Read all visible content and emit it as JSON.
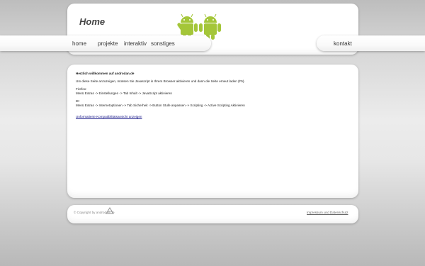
{
  "header": {
    "title": "Home"
  },
  "nav": {
    "items": [
      {
        "label": "home"
      },
      {
        "label": "projekte"
      },
      {
        "label": "interaktiv"
      },
      {
        "label": "sonstiges"
      }
    ],
    "contact": "kontakt"
  },
  "content": {
    "heading": "Herzlich willkommen auf androdan.de",
    "intro": "Um diese Seite anzuzeigen, müssen Sie Javascript in Ihrem Browser aktivieren und dann die Seite erneut laden (F5).",
    "firefox_label": "Firefox:",
    "firefox_steps": "Menü Extras -> Einstellungen -> Tab Inhalt -> JavaScript aktivieren",
    "ie_label": "IE:",
    "ie_steps": "Menü Extras -> Internetoptionen -> Tab Sicherheit -> Button Stufe anpassen -> Scripting -> Active Scripting Aktivieren",
    "compat_link": "Unformatierte Kompatibilitätsansicht anzeigen"
  },
  "footer": {
    "copyright": "© Copyright by androdan.de",
    "legal_link": "Impressum und Datenschutz"
  },
  "colors": {
    "android_green": "#a4c639",
    "link_blue": "#1a1a8a"
  },
  "icons": {
    "header_graphic": "android-robots-icon",
    "footer_graphic": "androdan-logo-icon"
  }
}
